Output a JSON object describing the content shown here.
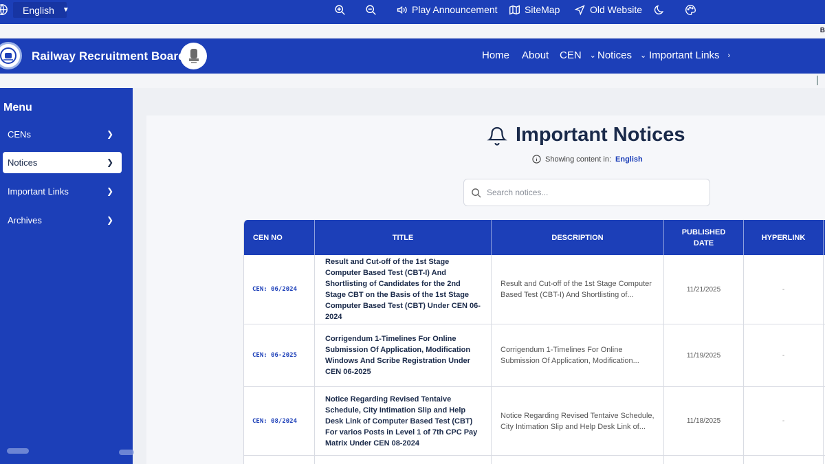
{
  "topbar": {
    "language": "English",
    "zoom_in_icon": "zoom-in-icon",
    "zoom_out_icon": "zoom-out-icon",
    "play_announcement": "Play Announcement",
    "sitemap": "SiteMap",
    "old_website": "Old Website",
    "theme_icon": "moon-icon",
    "palette_icon": "palette-icon"
  },
  "ticker": {
    "visible_text": "B"
  },
  "header": {
    "brand": "Railway Recruitment Board",
    "nav": {
      "home": "Home",
      "about": "About",
      "cen": "CEN",
      "notices": "Notices",
      "important_links": "Important Links"
    }
  },
  "sidebar": {
    "title": "Menu",
    "items": [
      {
        "label": "CENs",
        "active": false
      },
      {
        "label": "Notices",
        "active": true
      },
      {
        "label": "Important Links",
        "active": false
      },
      {
        "label": "Archives",
        "active": false
      }
    ]
  },
  "main": {
    "title": "Important Notices",
    "showing_label": "Showing content in:",
    "language": "English",
    "search_placeholder": "Search notices..."
  },
  "table": {
    "headers": [
      "CEN NO",
      "TITLE",
      "DESCRIPTION",
      "PUBLISHED DATE",
      "HYPERLINK"
    ],
    "rows": [
      {
        "cen": "CEN: 06/2024",
        "title": "Result and Cut-off of the 1st Stage Computer Based Test (CBT-I) And Shortlisting of Candidates for the 2nd Stage CBT on the Basis of the 1st Stage Computer Based Test (CBT) Under CEN 06-2024",
        "description": "Result and Cut-off of the 1st Stage Computer Based Test (CBT-I) And Shortlisting of...",
        "date": "11/21/2025",
        "link": "-"
      },
      {
        "cen": "CEN: 06-2025",
        "title": "Corrigendum 1-Timelines For Online Submission Of Application, Modification Windows And Scribe Registration Under CEN 06-2025",
        "description": "Corrigendum 1-Timelines For Online Submission Of Application, Modification...",
        "date": "11/19/2025",
        "link": "-"
      },
      {
        "cen": "CEN: 08/2024",
        "title": "Notice Regarding Revised Tentaive Schedule, City Intimation Slip and Help Desk Link of Computer Based Test (CBT) For varios Posts in Level 1 of 7th CPC Pay Matrix Under CEN 08-2024",
        "description": "Notice Regarding Revised Tentaive Schedule, City Intimation Slip and Help Desk Link of...",
        "date": "11/18/2025",
        "link": "-"
      }
    ]
  },
  "colors": {
    "primary": "#1c3fb8",
    "background": "#eef0f4",
    "text": "#1a2a4a"
  }
}
